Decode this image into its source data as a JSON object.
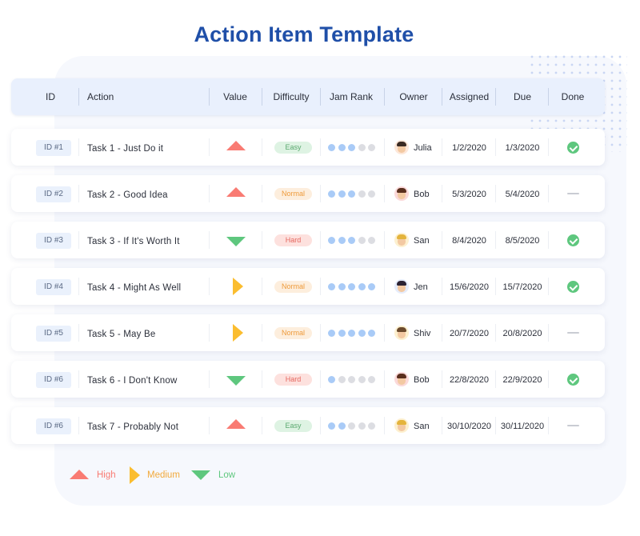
{
  "title": "Action Item Template",
  "columns": [
    "ID",
    "Action",
    "Value",
    "Difficulty",
    "Jam Rank",
    "Owner",
    "Assigned",
    "Due",
    "Done"
  ],
  "colors": {
    "title": "#1f4fa8",
    "high": "#f97b73",
    "medium": "#fbbd2f",
    "low": "#5ec77e",
    "rank_on": "#a9cbf7",
    "rank_off": "#dcdde2"
  },
  "rows": [
    {
      "id": "ID #1",
      "action": "Task 1 - Just Do it",
      "value": "high",
      "difficulty": "Easy",
      "jam_rank": 3,
      "owner": "Julia",
      "avatar": "avatar-julia-icon",
      "assigned": "1/2/2020",
      "due": "1/3/2020",
      "done": true
    },
    {
      "id": "ID #2",
      "action": "Task 2 - Good Idea",
      "value": "high",
      "difficulty": "Normal",
      "jam_rank": 3,
      "owner": "Bob",
      "avatar": "avatar-bob-icon",
      "assigned": "5/3/2020",
      "due": "5/4/2020",
      "done": false
    },
    {
      "id": "ID #3",
      "action": "Task 3 - If It's Worth It",
      "value": "low",
      "difficulty": "Hard",
      "jam_rank": 3,
      "owner": "San",
      "avatar": "avatar-san-icon",
      "assigned": "8/4/2020",
      "due": "8/5/2020",
      "done": true
    },
    {
      "id": "ID #4",
      "action": "Task 4 - Might As Well",
      "value": "medium",
      "difficulty": "Normal",
      "jam_rank": 5,
      "owner": "Jen",
      "avatar": "avatar-jen-icon",
      "assigned": "15/6/2020",
      "due": "15/7/2020",
      "done": true
    },
    {
      "id": "ID #5",
      "action": "Task 5 - May Be",
      "value": "medium",
      "difficulty": "Normal",
      "jam_rank": 5,
      "owner": "Shiv",
      "avatar": "avatar-shiv-icon",
      "assigned": "20/7/2020",
      "due": "20/8/2020",
      "done": false
    },
    {
      "id": "ID #6",
      "action": "Task 6 - I Don't Know",
      "value": "low",
      "difficulty": "Hard",
      "jam_rank": 1,
      "owner": "Bob",
      "avatar": "avatar-bob-icon",
      "assigned": "22/8/2020",
      "due": "22/9/2020",
      "done": true
    },
    {
      "id": "ID #6",
      "action": "Task 7 - Probably Not",
      "value": "high",
      "difficulty": "Easy",
      "jam_rank": 2,
      "owner": "San",
      "avatar": "avatar-san-icon",
      "assigned": "30/10/2020",
      "due": "30/11/2020",
      "done": false
    }
  ],
  "legend": [
    {
      "key": "high",
      "label": "High"
    },
    {
      "key": "medium",
      "label": "Medium"
    },
    {
      "key": "low",
      "label": "Low"
    }
  ]
}
